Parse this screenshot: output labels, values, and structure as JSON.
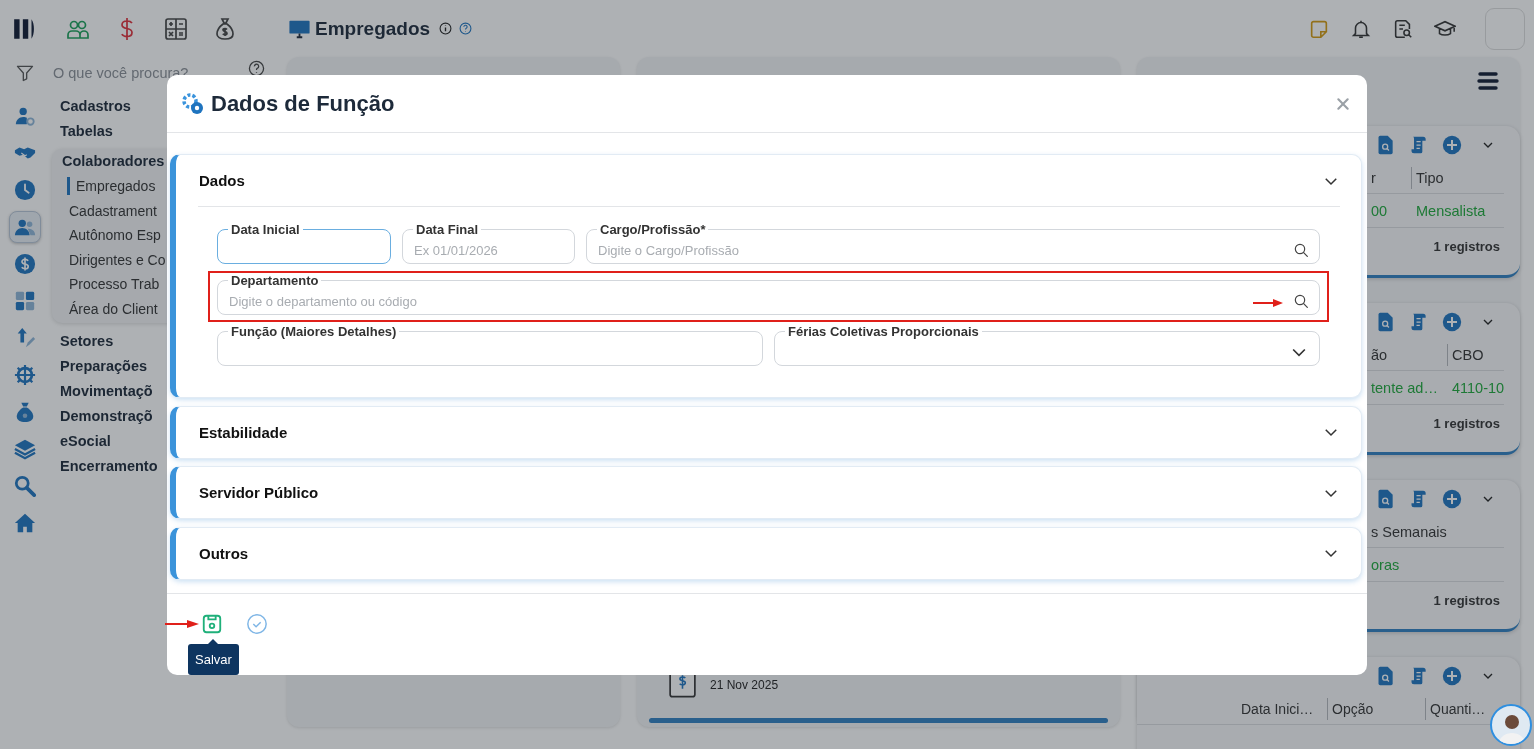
{
  "top_bar": {
    "page_title": "Empregados"
  },
  "rail_items": [
    {
      "kind": "user-gear",
      "selected": false
    },
    {
      "kind": "handshake",
      "selected": false
    },
    {
      "kind": "clock",
      "selected": false
    },
    {
      "kind": "people",
      "selected": true
    },
    {
      "kind": "dollar",
      "selected": false
    },
    {
      "kind": "calculator",
      "selected": false
    },
    {
      "kind": "arrow-pen",
      "selected": false
    },
    {
      "kind": "gear",
      "selected": false
    },
    {
      "kind": "money-bag",
      "selected": false
    },
    {
      "kind": "layers",
      "selected": false
    },
    {
      "kind": "search",
      "selected": false
    },
    {
      "kind": "home",
      "selected": false
    }
  ],
  "search": {
    "placeholder": "O que você procura?"
  },
  "menu": [
    {
      "label": "Cadastros"
    },
    {
      "label": "Tabelas"
    },
    {
      "label": "Colaboradores",
      "children": [
        {
          "label": "Empregados",
          "selected": true
        },
        {
          "label": "Cadastrament",
          "selected": false
        },
        {
          "label": "Autônomo Esp",
          "selected": false
        },
        {
          "label": "Dirigentes e Co",
          "selected": false
        },
        {
          "label": "Processo Trab",
          "selected": false
        },
        {
          "label": "Área do Client",
          "selected": false
        }
      ]
    },
    {
      "label": "Setores"
    },
    {
      "label": "Preparações"
    },
    {
      "label": "Movimentaçõ"
    },
    {
      "label": "Demonstraçõ"
    },
    {
      "label": "eSocial"
    },
    {
      "label": "Encerramento"
    }
  ],
  "timeline_entry": {
    "date": "21 Nov 2025"
  },
  "cards": [
    {
      "columns": [
        "r",
        "Tipo"
      ],
      "row": [
        "00",
        "Mensalista"
      ],
      "footer": "1 registros"
    },
    {
      "columns": [
        "ão",
        "CBO"
      ],
      "row": [
        "tente ad…",
        "4110-10"
      ],
      "footer": "1 registros"
    },
    {
      "columns": [
        "s Semanais"
      ],
      "row": [
        "oras"
      ],
      "footer": "1 registros"
    },
    {
      "columns": [
        "Data Inici…",
        "Opção",
        "Quanti…"
      ]
    }
  ],
  "dialog": {
    "title": "Dados de Função",
    "sections": [
      {
        "title": "Dados",
        "expanded": true,
        "rows": [
          {
            "fields": [
              {
                "kind": "date",
                "label": "Data Inicial",
                "focused": true,
                "highlighted": false
              },
              {
                "kind": "date",
                "label": "Data Final",
                "placeholder": "Ex 01/01/2026",
                "focused": false,
                "highlighted": false
              },
              {
                "kind": "search",
                "label": "Cargo/Profissão*",
                "placeholder": "Digite o Cargo/Profissão",
                "focused": false,
                "highlighted": false
              }
            ]
          },
          {
            "fields": [
              {
                "kind": "search",
                "label": "Departamento",
                "placeholder": "Digite o departamento ou código",
                "focused": false,
                "highlighted": true
              }
            ]
          },
          {
            "fields": [
              {
                "kind": "text",
                "label": "Função (Maiores Detalhes)",
                "focused": false,
                "highlighted": false
              },
              {
                "kind": "select",
                "label": "Férias Coletivas Proporcionais",
                "focused": false,
                "highlighted": false
              }
            ]
          }
        ]
      },
      {
        "title": "Estabilidade",
        "expanded": false
      },
      {
        "title": "Servidor Público",
        "expanded": false
      },
      {
        "title": "Outros",
        "expanded": false
      }
    ],
    "actions": [
      {
        "kind": "save",
        "tooltip": "Salvar",
        "highlighted": true
      },
      {
        "kind": "confirm",
        "highlighted": false
      }
    ]
  }
}
